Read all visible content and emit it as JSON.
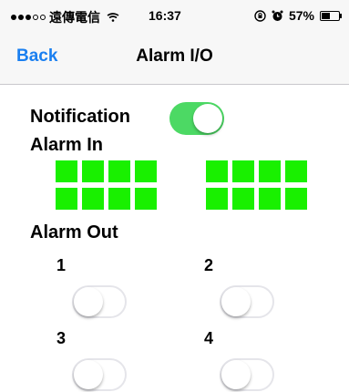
{
  "status_bar": {
    "carrier": "遠傳電信",
    "time": "16:37",
    "battery_text": "57%",
    "battery_level": 0.57,
    "icons": [
      "signal-dots-icon",
      "wifi-icon",
      "rotation-lock-icon",
      "alarm-clock-icon",
      "battery-icon"
    ]
  },
  "nav": {
    "back_label": "Back",
    "title": "Alarm I/O"
  },
  "notification": {
    "label": "Notification",
    "enabled": true
  },
  "alarm_in": {
    "label": "Alarm In",
    "groups": [
      {
        "indicators": [
          "on",
          "on",
          "on",
          "on",
          "on",
          "on",
          "on",
          "on"
        ]
      },
      {
        "indicators": [
          "on",
          "on",
          "on",
          "on",
          "on",
          "on",
          "on",
          "on"
        ]
      }
    ],
    "active_color": "#19f000"
  },
  "alarm_out": {
    "label": "Alarm Out",
    "outputs": [
      {
        "number": "1",
        "enabled": false
      },
      {
        "number": "2",
        "enabled": false
      },
      {
        "number": "3",
        "enabled": false
      },
      {
        "number": "4",
        "enabled": false
      }
    ]
  },
  "colors": {
    "accent": "#1a7ff0",
    "toggle_on": "#4cd964"
  }
}
